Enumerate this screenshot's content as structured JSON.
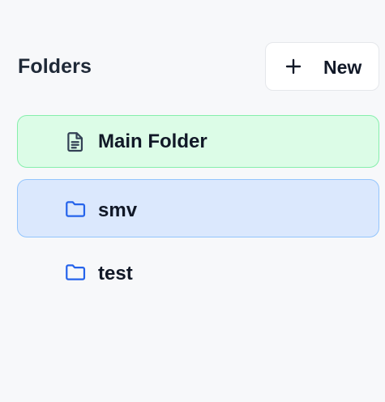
{
  "header": {
    "title": "Folders",
    "new_button_label": "New"
  },
  "icons": {
    "new": "plus-icon",
    "main_folder": "document-icon",
    "folder": "folder-icon"
  },
  "colors": {
    "background": "#f7f8fa",
    "selected_green_bg": "#dcfce7",
    "selected_green_border": "#86efac",
    "active_blue_bg": "#dbe8fd",
    "active_blue_border": "#93c5fd",
    "folder_icon": "#2563eb",
    "document_icon": "#334155"
  },
  "folders": [
    {
      "name": "Main Folder",
      "icon": "document-icon",
      "state": "selected"
    },
    {
      "name": "smv",
      "icon": "folder-icon",
      "state": "active"
    },
    {
      "name": "test",
      "icon": "folder-icon",
      "state": "default"
    }
  ]
}
